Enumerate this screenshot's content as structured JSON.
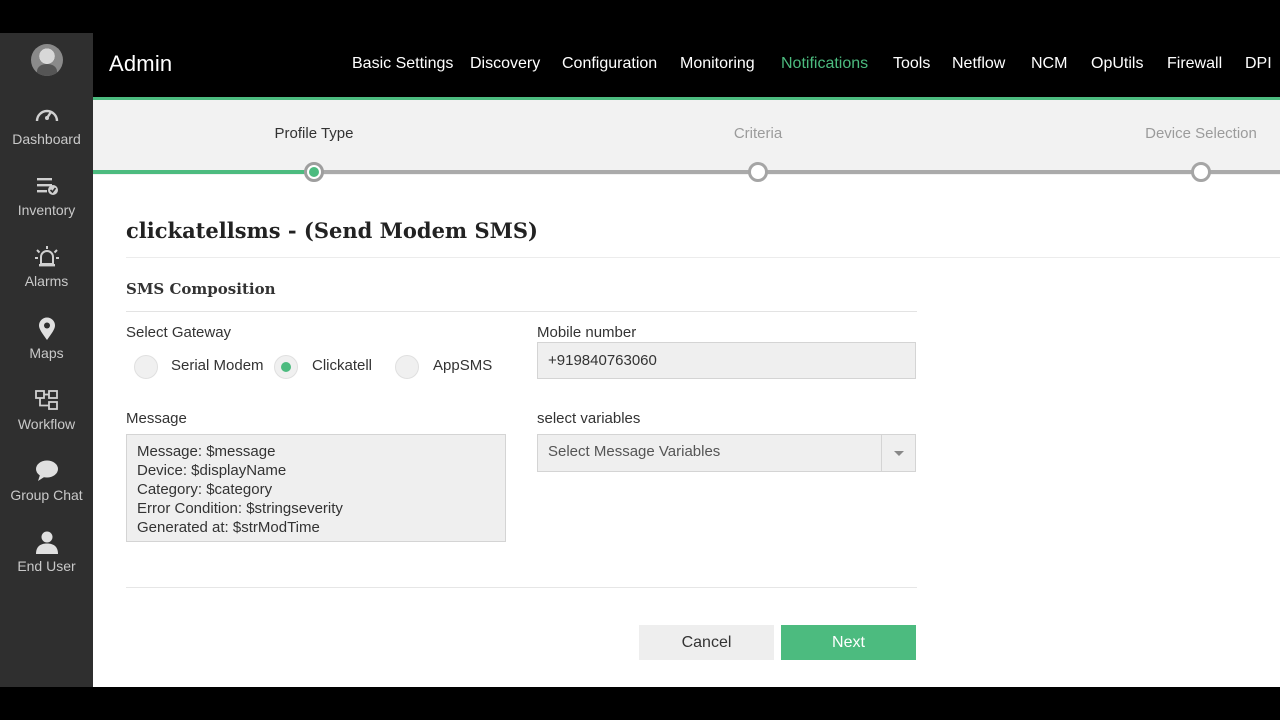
{
  "sidebar": {
    "items": [
      {
        "label": "Dashboard",
        "icon": "speedometer-icon"
      },
      {
        "label": "Inventory",
        "icon": "list-check-icon"
      },
      {
        "label": "Alarms",
        "icon": "alarm-icon"
      },
      {
        "label": "Maps",
        "icon": "map-pin-icon"
      },
      {
        "label": "Workflow",
        "icon": "workflow-icon"
      },
      {
        "label": "Group Chat",
        "icon": "chat-icon"
      },
      {
        "label": "End User",
        "icon": "user-icon"
      }
    ]
  },
  "header": {
    "title": "Admin",
    "nav": [
      "Basic Settings",
      "Discovery",
      "Configuration",
      "Monitoring",
      "Notifications",
      "Tools",
      "Netflow",
      "NCM",
      "OpUtils",
      "Firewall",
      "DPI"
    ],
    "active_nav": "Notifications"
  },
  "stepper": {
    "steps": [
      "Profile Type",
      "Criteria",
      "Device Selection"
    ],
    "active_step": "Profile Type"
  },
  "form": {
    "title": "clickatellsms - (Send Modem SMS)",
    "section_title": "SMS Composition",
    "gateway_label": "Select Gateway",
    "gateway_options": [
      "Serial Modem",
      "Clickatell",
      "AppSMS"
    ],
    "gateway_selected": "Clickatell",
    "mobile_label": "Mobile number",
    "mobile_value": "+919840763060",
    "message_label": "Message",
    "message_lines": [
      "Message: $message",
      "Device: $displayName",
      "Category: $category",
      "Error Condition: $stringseverity",
      "Generated at: $strModTime"
    ],
    "variables_label": "select variables",
    "variables_placeholder": "Select Message Variables",
    "cancel_label": "Cancel",
    "next_label": "Next"
  },
  "colors": {
    "accent": "#4cbb7f",
    "sidebar": "#2f2f2f",
    "header": "#000000"
  }
}
